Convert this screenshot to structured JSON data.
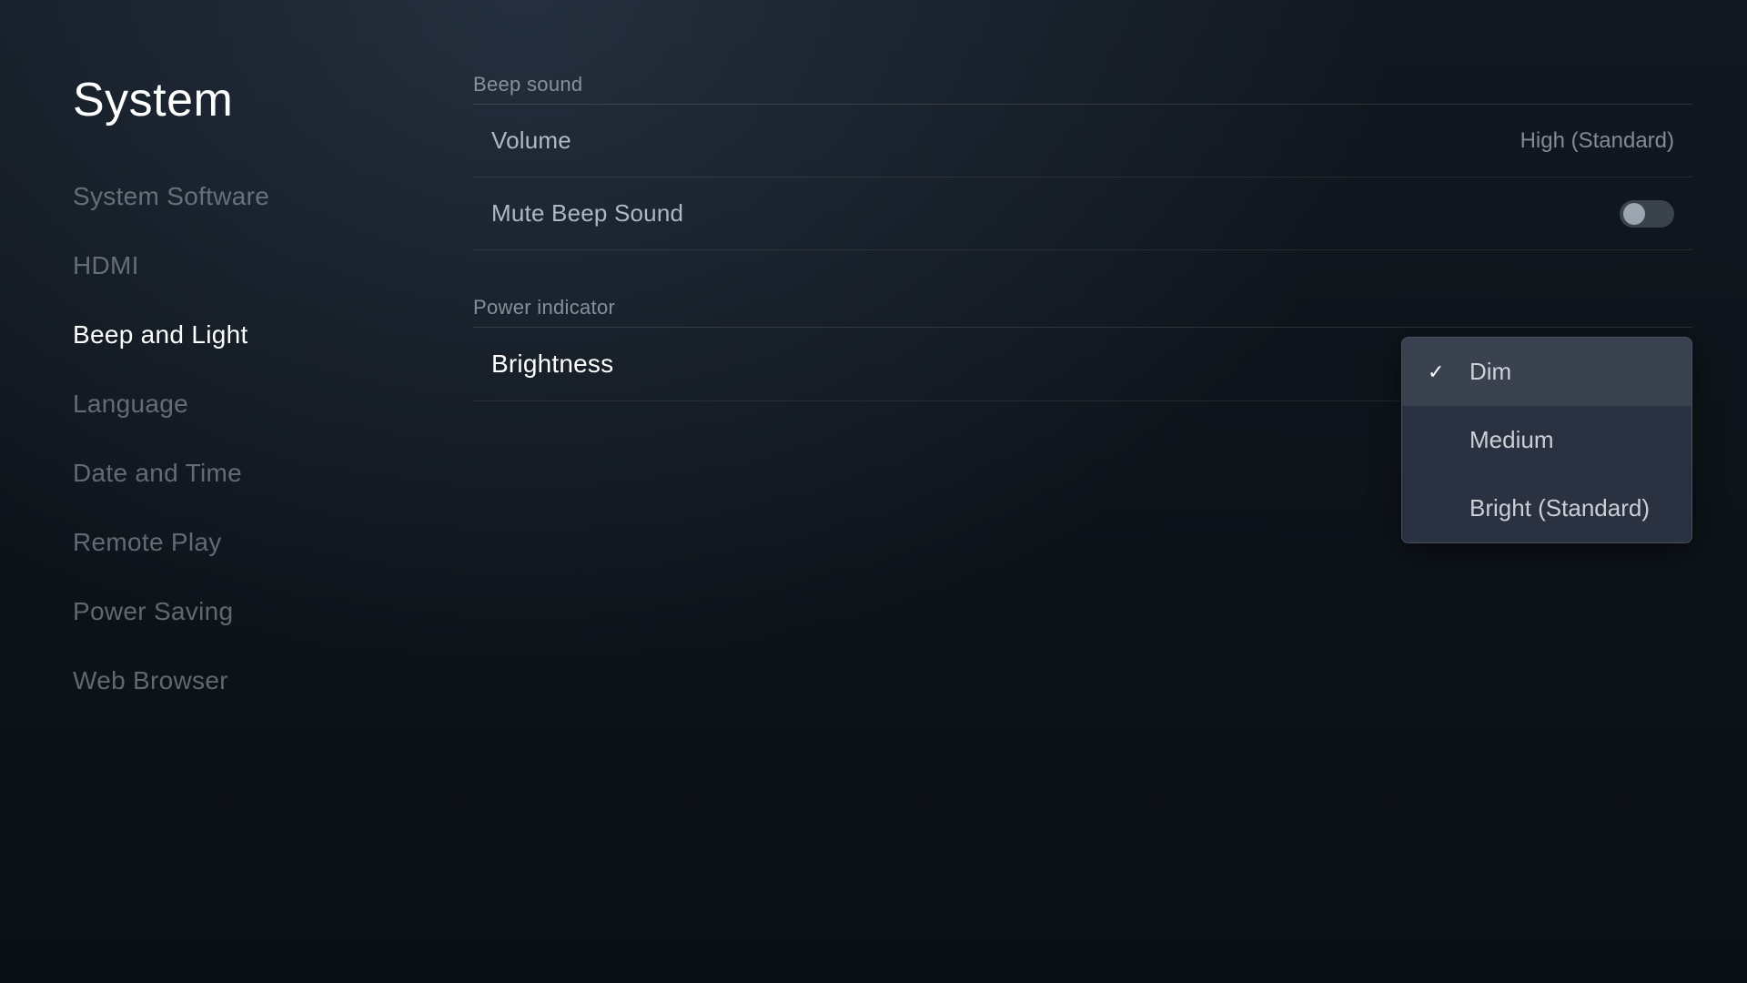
{
  "page": {
    "title": "System"
  },
  "sidebar": {
    "items": [
      {
        "id": "system-software",
        "label": "System Software",
        "active": false
      },
      {
        "id": "hdmi",
        "label": "HDMI",
        "active": false
      },
      {
        "id": "beep-and-light",
        "label": "Beep and Light",
        "active": true
      },
      {
        "id": "language",
        "label": "Language",
        "active": false
      },
      {
        "id": "date-and-time",
        "label": "Date and Time",
        "active": false
      },
      {
        "id": "remote-play",
        "label": "Remote Play",
        "active": false
      },
      {
        "id": "power-saving",
        "label": "Power Saving",
        "active": false
      },
      {
        "id": "web-browser",
        "label": "Web Browser",
        "active": false
      }
    ]
  },
  "beep_sound": {
    "section_title": "Beep sound",
    "volume_label": "Volume",
    "volume_value": "High (Standard)",
    "mute_label": "Mute Beep Sound",
    "mute_enabled": false
  },
  "power_indicator": {
    "section_title": "Power indicator",
    "brightness_label": "Brightness",
    "dropdown": {
      "options": [
        {
          "id": "dim",
          "label": "Dim",
          "selected": true
        },
        {
          "id": "medium",
          "label": "Medium",
          "selected": false
        },
        {
          "id": "bright-standard",
          "label": "Bright (Standard)",
          "selected": false
        }
      ]
    }
  },
  "icons": {
    "checkmark": "✓"
  }
}
